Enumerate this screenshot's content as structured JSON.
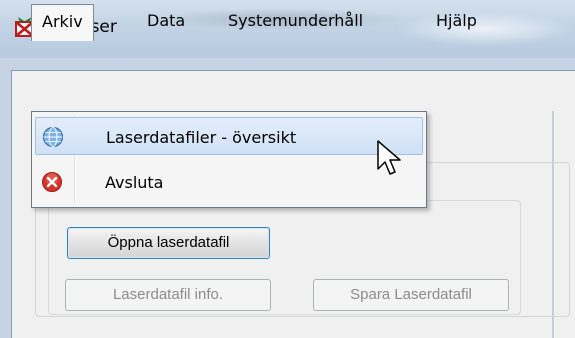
{
  "window": {
    "title": "OL-Laser",
    "icon": "red-x-gift-icon"
  },
  "menubar": {
    "items": [
      {
        "label": "Arkiv",
        "active": true
      },
      {
        "label": "Data"
      },
      {
        "label": "Systemunderhåll"
      },
      {
        "label": "Hjälp"
      }
    ]
  },
  "dropdown": {
    "items": [
      {
        "label": "Laserdatafiler - översikt",
        "icon": "globe-icon",
        "highlighted": true
      },
      {
        "label": "Avsluta",
        "icon": "red-close-icon"
      }
    ]
  },
  "buttons": {
    "open": "Öppna laserdatafil",
    "info": "Laserdatafil info.",
    "save": "Spara Laserdatafil"
  },
  "colors": {
    "highlight": "#cfe1f6",
    "focus_border": "#3c7fb1",
    "disabled_text": "#8c8c8c",
    "exit_icon": "#d8322a"
  }
}
